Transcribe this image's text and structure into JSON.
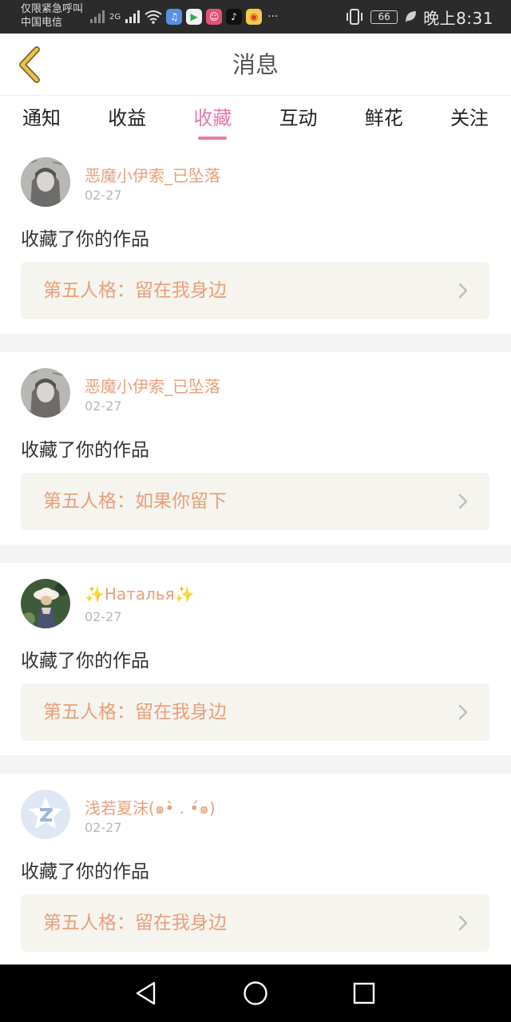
{
  "status_bar": {
    "carrier_line1": "仅限紧急呼叫",
    "carrier_line2": "中国电信",
    "network_label": "2G",
    "more_dots": "···",
    "battery": "66",
    "time": "晚上8:31",
    "icons": [
      "signal-icon",
      "wifi-icon",
      "music-app-icon",
      "play-app-icon",
      "mask-app-icon",
      "tiktok-icon",
      "weibo-icon",
      "vibrate-icon",
      "battery-icon",
      "leaf-icon"
    ]
  },
  "header": {
    "title": "消息",
    "back_icon": "chevron-left-icon",
    "accent_color": "#e8c24a"
  },
  "tabs": [
    {
      "label": "通知",
      "active": false
    },
    {
      "label": "收益",
      "active": false
    },
    {
      "label": "收藏",
      "active": true
    },
    {
      "label": "互动",
      "active": false
    },
    {
      "label": "鲜花",
      "active": false
    },
    {
      "label": "关注",
      "active": false
    }
  ],
  "theme": {
    "active_tab_color": "#e57aa7",
    "name_color": "#e8a07a",
    "work_box_bg": "#f5f4ee"
  },
  "notifications": [
    {
      "username": "恶魔小伊索_已坠落",
      "date": "02-27",
      "action": "收藏了你的作品",
      "work_title": "第五人格：留在我身边",
      "avatar": "avatar-gray-anime"
    },
    {
      "username": "恶魔小伊索_已坠落",
      "date": "02-27",
      "action": "收藏了你的作品",
      "work_title": "第五人格：如果你留下",
      "avatar": "avatar-gray-anime"
    },
    {
      "username": "✨Наталья✨",
      "date": "02-27",
      "action": "收藏了你的作品",
      "work_title": "第五人格：留在我身边",
      "avatar": "avatar-photo-hat"
    },
    {
      "username": "浅若夏沫(๑•̀ . •́๑)",
      "date": "02-27",
      "action": "收藏了你的作品",
      "work_title": "第五人格：留在我身边",
      "avatar": "avatar-default-qq"
    }
  ],
  "nav_bar": {
    "back_icon": "triangle-back-icon",
    "home_icon": "circle-home-icon",
    "recent_icon": "square-recent-icon"
  }
}
